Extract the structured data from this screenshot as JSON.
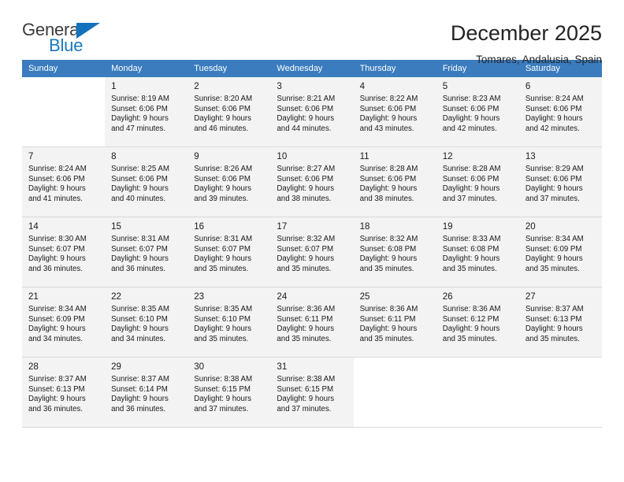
{
  "brand": {
    "name_top": "General",
    "name_bottom": "Blue",
    "triangle_color": "#1372bb",
    "blue_text_color": "#1879bf"
  },
  "header": {
    "title": "December 2025",
    "subtitle": "Tomares, Andalusia, Spain"
  },
  "theme": {
    "header_row_bg": "#3a7cbe",
    "header_row_text": "#ffffff",
    "shaded_cell_bg": "#f3f3f3",
    "grid_line": "#d9d9d9"
  },
  "weekday_headers": [
    "Sunday",
    "Monday",
    "Tuesday",
    "Wednesday",
    "Thursday",
    "Friday",
    "Saturday"
  ],
  "weeks": [
    [
      {
        "day": "",
        "sunrise": "",
        "sunset": "",
        "daylight_1": "",
        "daylight_2": "",
        "empty": true
      },
      {
        "day": "1",
        "sunrise": "Sunrise: 8:19 AM",
        "sunset": "Sunset: 6:06 PM",
        "daylight_1": "Daylight: 9 hours",
        "daylight_2": "and 47 minutes."
      },
      {
        "day": "2",
        "sunrise": "Sunrise: 8:20 AM",
        "sunset": "Sunset: 6:06 PM",
        "daylight_1": "Daylight: 9 hours",
        "daylight_2": "and 46 minutes."
      },
      {
        "day": "3",
        "sunrise": "Sunrise: 8:21 AM",
        "sunset": "Sunset: 6:06 PM",
        "daylight_1": "Daylight: 9 hours",
        "daylight_2": "and 44 minutes."
      },
      {
        "day": "4",
        "sunrise": "Sunrise: 8:22 AM",
        "sunset": "Sunset: 6:06 PM",
        "daylight_1": "Daylight: 9 hours",
        "daylight_2": "and 43 minutes."
      },
      {
        "day": "5",
        "sunrise": "Sunrise: 8:23 AM",
        "sunset": "Sunset: 6:06 PM",
        "daylight_1": "Daylight: 9 hours",
        "daylight_2": "and 42 minutes."
      },
      {
        "day": "6",
        "sunrise": "Sunrise: 8:24 AM",
        "sunset": "Sunset: 6:06 PM",
        "daylight_1": "Daylight: 9 hours",
        "daylight_2": "and 42 minutes."
      }
    ],
    [
      {
        "day": "7",
        "sunrise": "Sunrise: 8:24 AM",
        "sunset": "Sunset: 6:06 PM",
        "daylight_1": "Daylight: 9 hours",
        "daylight_2": "and 41 minutes."
      },
      {
        "day": "8",
        "sunrise": "Sunrise: 8:25 AM",
        "sunset": "Sunset: 6:06 PM",
        "daylight_1": "Daylight: 9 hours",
        "daylight_2": "and 40 minutes."
      },
      {
        "day": "9",
        "sunrise": "Sunrise: 8:26 AM",
        "sunset": "Sunset: 6:06 PM",
        "daylight_1": "Daylight: 9 hours",
        "daylight_2": "and 39 minutes."
      },
      {
        "day": "10",
        "sunrise": "Sunrise: 8:27 AM",
        "sunset": "Sunset: 6:06 PM",
        "daylight_1": "Daylight: 9 hours",
        "daylight_2": "and 38 minutes."
      },
      {
        "day": "11",
        "sunrise": "Sunrise: 8:28 AM",
        "sunset": "Sunset: 6:06 PM",
        "daylight_1": "Daylight: 9 hours",
        "daylight_2": "and 38 minutes."
      },
      {
        "day": "12",
        "sunrise": "Sunrise: 8:28 AM",
        "sunset": "Sunset: 6:06 PM",
        "daylight_1": "Daylight: 9 hours",
        "daylight_2": "and 37 minutes."
      },
      {
        "day": "13",
        "sunrise": "Sunrise: 8:29 AM",
        "sunset": "Sunset: 6:06 PM",
        "daylight_1": "Daylight: 9 hours",
        "daylight_2": "and 37 minutes."
      }
    ],
    [
      {
        "day": "14",
        "sunrise": "Sunrise: 8:30 AM",
        "sunset": "Sunset: 6:07 PM",
        "daylight_1": "Daylight: 9 hours",
        "daylight_2": "and 36 minutes."
      },
      {
        "day": "15",
        "sunrise": "Sunrise: 8:31 AM",
        "sunset": "Sunset: 6:07 PM",
        "daylight_1": "Daylight: 9 hours",
        "daylight_2": "and 36 minutes."
      },
      {
        "day": "16",
        "sunrise": "Sunrise: 8:31 AM",
        "sunset": "Sunset: 6:07 PM",
        "daylight_1": "Daylight: 9 hours",
        "daylight_2": "and 35 minutes."
      },
      {
        "day": "17",
        "sunrise": "Sunrise: 8:32 AM",
        "sunset": "Sunset: 6:07 PM",
        "daylight_1": "Daylight: 9 hours",
        "daylight_2": "and 35 minutes."
      },
      {
        "day": "18",
        "sunrise": "Sunrise: 8:32 AM",
        "sunset": "Sunset: 6:08 PM",
        "daylight_1": "Daylight: 9 hours",
        "daylight_2": "and 35 minutes."
      },
      {
        "day": "19",
        "sunrise": "Sunrise: 8:33 AM",
        "sunset": "Sunset: 6:08 PM",
        "daylight_1": "Daylight: 9 hours",
        "daylight_2": "and 35 minutes."
      },
      {
        "day": "20",
        "sunrise": "Sunrise: 8:34 AM",
        "sunset": "Sunset: 6:09 PM",
        "daylight_1": "Daylight: 9 hours",
        "daylight_2": "and 35 minutes."
      }
    ],
    [
      {
        "day": "21",
        "sunrise": "Sunrise: 8:34 AM",
        "sunset": "Sunset: 6:09 PM",
        "daylight_1": "Daylight: 9 hours",
        "daylight_2": "and 34 minutes."
      },
      {
        "day": "22",
        "sunrise": "Sunrise: 8:35 AM",
        "sunset": "Sunset: 6:10 PM",
        "daylight_1": "Daylight: 9 hours",
        "daylight_2": "and 34 minutes."
      },
      {
        "day": "23",
        "sunrise": "Sunrise: 8:35 AM",
        "sunset": "Sunset: 6:10 PM",
        "daylight_1": "Daylight: 9 hours",
        "daylight_2": "and 35 minutes."
      },
      {
        "day": "24",
        "sunrise": "Sunrise: 8:36 AM",
        "sunset": "Sunset: 6:11 PM",
        "daylight_1": "Daylight: 9 hours",
        "daylight_2": "and 35 minutes."
      },
      {
        "day": "25",
        "sunrise": "Sunrise: 8:36 AM",
        "sunset": "Sunset: 6:11 PM",
        "daylight_1": "Daylight: 9 hours",
        "daylight_2": "and 35 minutes."
      },
      {
        "day": "26",
        "sunrise": "Sunrise: 8:36 AM",
        "sunset": "Sunset: 6:12 PM",
        "daylight_1": "Daylight: 9 hours",
        "daylight_2": "and 35 minutes."
      },
      {
        "day": "27",
        "sunrise": "Sunrise: 8:37 AM",
        "sunset": "Sunset: 6:13 PM",
        "daylight_1": "Daylight: 9 hours",
        "daylight_2": "and 35 minutes."
      }
    ],
    [
      {
        "day": "28",
        "sunrise": "Sunrise: 8:37 AM",
        "sunset": "Sunset: 6:13 PM",
        "daylight_1": "Daylight: 9 hours",
        "daylight_2": "and 36 minutes."
      },
      {
        "day": "29",
        "sunrise": "Sunrise: 8:37 AM",
        "sunset": "Sunset: 6:14 PM",
        "daylight_1": "Daylight: 9 hours",
        "daylight_2": "and 36 minutes."
      },
      {
        "day": "30",
        "sunrise": "Sunrise: 8:38 AM",
        "sunset": "Sunset: 6:15 PM",
        "daylight_1": "Daylight: 9 hours",
        "daylight_2": "and 37 minutes."
      },
      {
        "day": "31",
        "sunrise": "Sunrise: 8:38 AM",
        "sunset": "Sunset: 6:15 PM",
        "daylight_1": "Daylight: 9 hours",
        "daylight_2": "and 37 minutes."
      },
      {
        "day": "",
        "sunrise": "",
        "sunset": "",
        "daylight_1": "",
        "daylight_2": "",
        "empty": true
      },
      {
        "day": "",
        "sunrise": "",
        "sunset": "",
        "daylight_1": "",
        "daylight_2": "",
        "empty": true
      },
      {
        "day": "",
        "sunrise": "",
        "sunset": "",
        "daylight_1": "",
        "daylight_2": "",
        "empty": true
      }
    ]
  ]
}
